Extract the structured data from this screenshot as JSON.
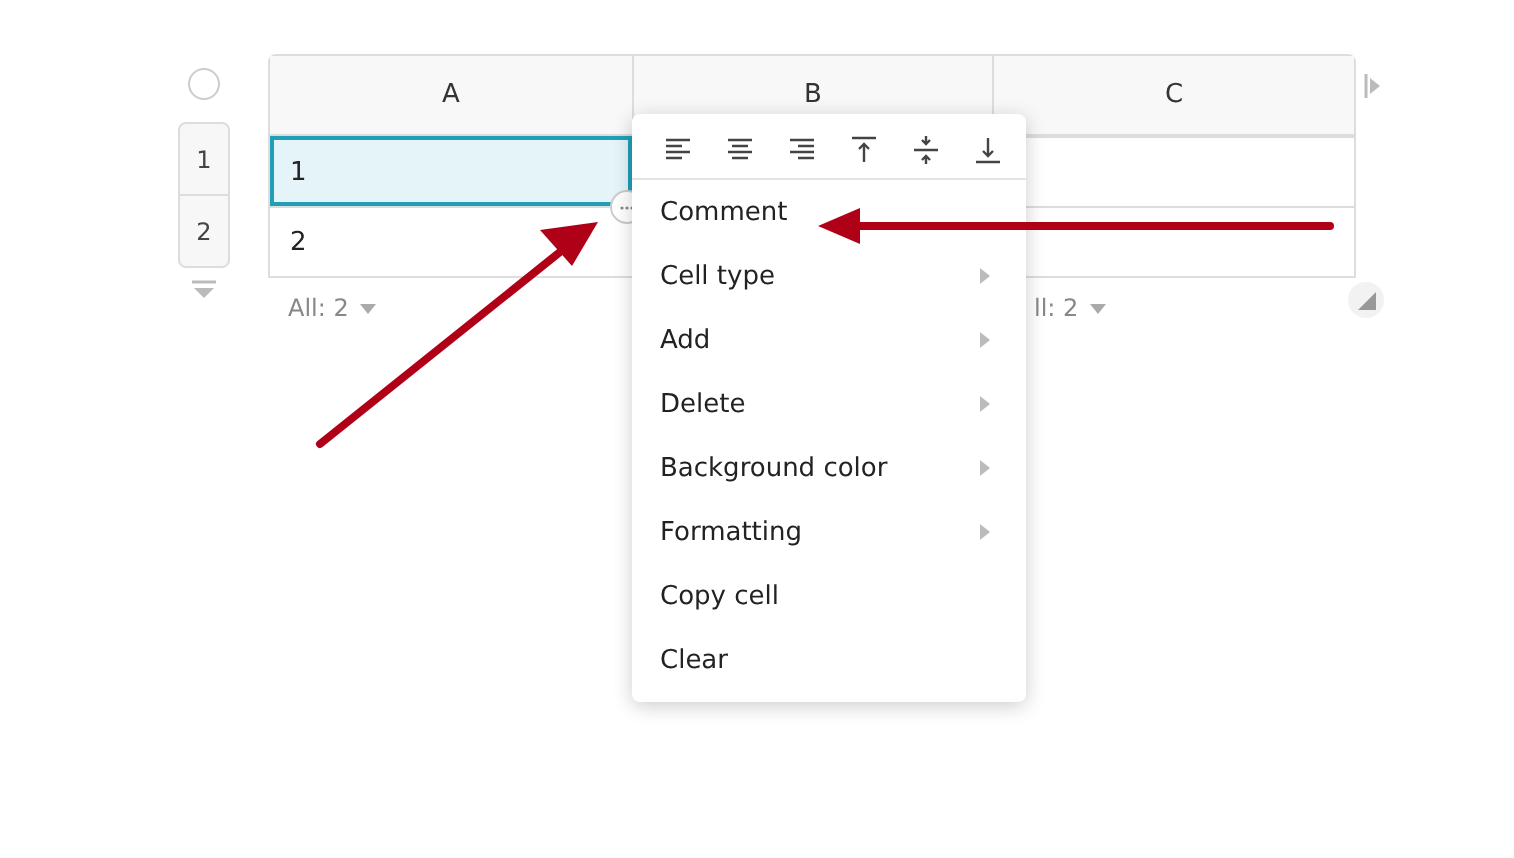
{
  "table": {
    "columns": [
      "A",
      "B",
      "C"
    ],
    "rows": [
      {
        "number": "1",
        "cells": [
          "1",
          "",
          ""
        ],
        "selected": true
      },
      {
        "number": "2",
        "cells": [
          "2",
          "",
          ""
        ],
        "selected": false
      }
    ],
    "select_all": {
      "checked": false
    },
    "summary_left": "All: 2",
    "summary_right": "ll: 2"
  },
  "context_menu": {
    "items": [
      {
        "label": "Comment",
        "has_submenu": false
      },
      {
        "label": "Cell type",
        "has_submenu": true
      },
      {
        "label": "Add",
        "has_submenu": true
      },
      {
        "label": "Delete",
        "has_submenu": true
      },
      {
        "label": "Background color",
        "has_submenu": true
      },
      {
        "label": "Formatting",
        "has_submenu": true
      },
      {
        "label": "Copy cell",
        "has_submenu": false
      },
      {
        "label": "Clear",
        "has_submenu": false
      }
    ]
  }
}
